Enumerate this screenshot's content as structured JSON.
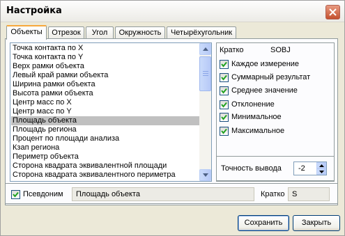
{
  "window": {
    "title": "Настройка"
  },
  "tabs": [
    {
      "label": "Объекты"
    },
    {
      "label": "Отрезок"
    },
    {
      "label": "Угол"
    },
    {
      "label": "Окружность"
    },
    {
      "label": "Четырёхугольник"
    }
  ],
  "objects_list": {
    "items": [
      "Точка контакта по X",
      "Точка контакта по Y",
      "Верх рамки объекта",
      "Левый край рамки объекта",
      "Ширина рамки объекта",
      "Высота рамки объекта",
      "Центр масс по X",
      "Центр масс по Y",
      "Площадь объекта",
      "Площадь региона",
      "Процент по площади анализа",
      "Кзап региона",
      "Периметр объекта",
      "Сторона квадрата эквивалентной площади",
      "Сторона квадрата эквивалентного периметра"
    ],
    "selected_index": 8
  },
  "details": {
    "short_label": "Кратко",
    "short_value": "SOBJ",
    "options": [
      {
        "label": "Каждое измерение",
        "checked": true
      },
      {
        "label": "Суммарный результат",
        "checked": true
      },
      {
        "label": "Среднее значение",
        "checked": true
      },
      {
        "label": "Отклонение",
        "checked": true
      },
      {
        "label": "Минимальное",
        "checked": true
      },
      {
        "label": "Максимальное",
        "checked": true
      }
    ],
    "precision_label": "Точность вывода",
    "precision_value": "-2"
  },
  "alias": {
    "checkbox_label": "Псевдоним",
    "checked": true,
    "value": "Площадь объекта",
    "short_label": "Кратко",
    "short_value": "S"
  },
  "buttons": {
    "save": "Сохранить",
    "close": "Закрыть"
  }
}
